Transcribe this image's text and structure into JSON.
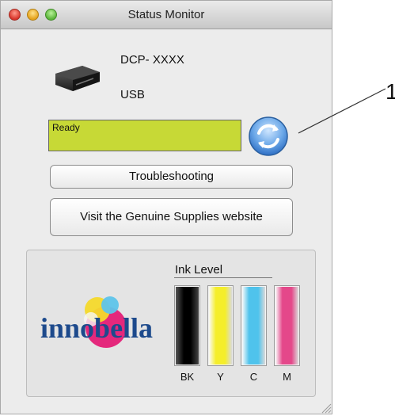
{
  "window": {
    "title": "Status Monitor"
  },
  "printer": {
    "model": "DCP- XXXX",
    "connection": "USB"
  },
  "status": {
    "text": "Ready",
    "color": "#c7d936"
  },
  "buttons": {
    "troubleshooting": "Troubleshooting",
    "visit_supplies": "Visit the Genuine Supplies website"
  },
  "ink": {
    "title": "Ink Level",
    "brand_logo": "innobella",
    "cartridges": [
      {
        "label": "BK",
        "color": "#000000",
        "level": 1.0
      },
      {
        "label": "Y",
        "color": "#f5ee2a",
        "level": 1.0
      },
      {
        "label": "C",
        "color": "#4fc3ec",
        "level": 1.0
      },
      {
        "label": "M",
        "color": "#e4488a",
        "level": 1.0
      }
    ]
  },
  "callout": {
    "number": "1"
  },
  "icons": {
    "printer": "printer-icon",
    "refresh": "refresh-icon",
    "resize": "resize-grip-icon"
  }
}
